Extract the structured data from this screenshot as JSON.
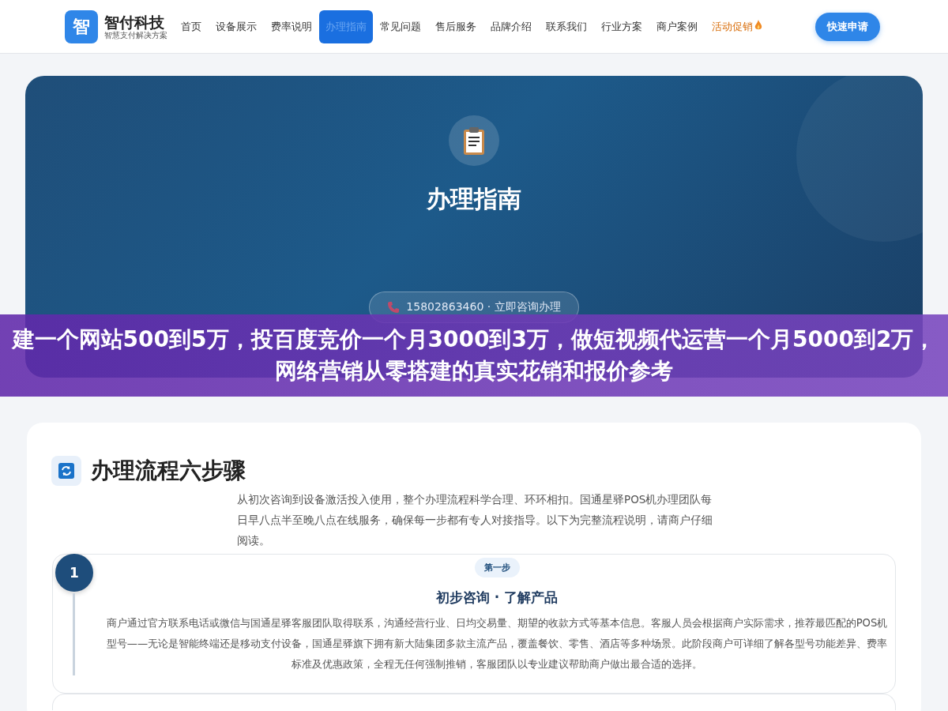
{
  "header": {
    "logo_char": "智",
    "brand": "智付科技",
    "tagline": "智慧支付解决方案",
    "nav": [
      {
        "label": "首页",
        "selected": false,
        "kind": "link"
      },
      {
        "label": "设备展示",
        "selected": false,
        "kind": "link"
      },
      {
        "label": "费率说明",
        "selected": false,
        "kind": "link"
      },
      {
        "label": "办理指南",
        "selected": true,
        "kind": "link"
      },
      {
        "label": "常见问题",
        "selected": false,
        "kind": "link"
      },
      {
        "label": "售后服务",
        "selected": false,
        "kind": "link"
      },
      {
        "label": "品牌介绍",
        "selected": false,
        "kind": "link"
      },
      {
        "label": "联系我们",
        "selected": false,
        "kind": "link"
      },
      {
        "label": "行业方案",
        "selected": false,
        "kind": "link"
      },
      {
        "label": "商户案例",
        "selected": false,
        "kind": "link"
      },
      {
        "label": "活动促销",
        "selected": false,
        "kind": "promo"
      }
    ],
    "cta": "快速申请"
  },
  "hero": {
    "title": "办理指南",
    "phone_button": "15802863460 · 立即咨询办理"
  },
  "banner": {
    "text": "建一个网站500到5万，投百度竞价一个月3000到3万，做短视频代运营一个月5000到2万，网络营销从零搭建的真实花销和报价参考"
  },
  "process": {
    "title": "办理流程六步骤",
    "intro": "从初次咨询到设备激活投入使用，整个办理流程科学合理、环环相扣。国通星驿POS机办理团队每日早八点半至晚八点在线服务，确保每一步都有专人对接指导。以下为完整流程说明，请商户仔细阅读。",
    "steps": [
      {
        "number": "1",
        "badge": "第一步",
        "title": "初步咨询 · 了解产品",
        "text": "商户通过官方联系电话或微信与国通星驿客服团队取得联系，沟通经营行业、日均交易量、期望的收款方式等基本信息。客服人员会根据商户实际需求，推荐最匹配的POS机型号——无论是智能终端还是移动支付设备，国通星驿旗下拥有新大陆集团多款主流产品，覆盖餐饮、零售、酒店等多种场景。此阶段商户可详细了解各型号功能差异、费率标准及优惠政策，全程无任何强制推销，客服团队以专业建议帮助商户做出最合适的选择。"
      }
    ]
  }
}
